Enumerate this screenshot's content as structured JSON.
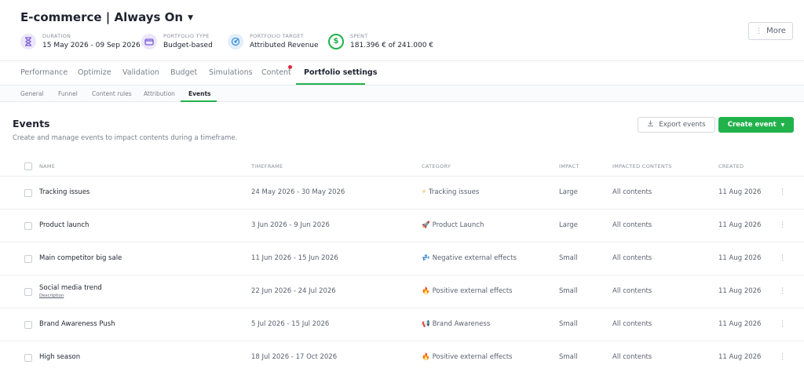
{
  "header": {
    "title": "E-commerce | Always On",
    "more_label": "More",
    "meta": [
      {
        "label": "DURATION",
        "value": "15 May 2026 - 09 Sep 2026",
        "icon": "hourglass-icon",
        "color": "#7b5cd6"
      },
      {
        "label": "PORTFOLIO TYPE",
        "value": "Budget-based",
        "icon": "wallet-icon",
        "color": "#7b5cd6"
      },
      {
        "label": "PORTFOLIO TARGET",
        "value": "Attributed Revenue",
        "icon": "target-icon",
        "color": "#3a8fd8"
      },
      {
        "label": "SPENT",
        "value": "181.396 € of 241.000 €",
        "icon": "dollar-circle-icon",
        "color": "#22b24c"
      }
    ]
  },
  "tabs": [
    "Performance",
    "Optimize",
    "Validation",
    "Budget",
    "Simulations",
    "Content",
    "Portfolio settings"
  ],
  "active_tab": "Portfolio settings",
  "subtabs": [
    "General",
    "Funnel",
    "Content rules",
    "Attribution",
    "Events"
  ],
  "active_subtab": "Events",
  "section": {
    "title": "Events",
    "description": "Create and manage events to impact contents during a timeframe.",
    "export_label": "Export events",
    "create_label": "Create event"
  },
  "table": {
    "headers": [
      "NAME",
      "TIMEFRAME",
      "CATEGORY",
      "IMPACT",
      "IMPACTED CONTENTS",
      "CREATED"
    ],
    "rows": [
      {
        "name": "Tracking issues",
        "timeframe": "24 May 2026 - 30 May 2026",
        "category_icon": "⚡",
        "category": "Tracking issues",
        "impact": "Large",
        "impacted": "All contents",
        "created": "11 Aug 2026"
      },
      {
        "name": "Product launch",
        "timeframe": "3 Jun 2026 - 9 Jun 2026",
        "category_icon": "🚀",
        "category": "Product Launch",
        "impact": "Large",
        "impacted": "All contents",
        "created": "11 Aug 2026"
      },
      {
        "name": "Main competitor big sale",
        "timeframe": "11 Jun 2026 - 15 Jun 2026",
        "category_icon": "💤",
        "category": "Negative external effects",
        "impact": "Small",
        "impacted": "All contents",
        "created": "11 Aug 2026"
      },
      {
        "name": "Social media trend",
        "description": "Description",
        "timeframe": "22 Jun 2026 - 24 Jul 2026",
        "category_icon": "🔥",
        "category": "Positive external effects",
        "impact": "Small",
        "impacted": "All contents",
        "created": "11 Aug 2026"
      },
      {
        "name": "Brand Awareness Push",
        "timeframe": "5 Jul 2026 - 15 Jul 2026",
        "category_icon": "📢",
        "category": "Brand Awareness",
        "impact": "Small",
        "impacted": "All contents",
        "created": "11 Aug 2026"
      },
      {
        "name": "High season",
        "timeframe": "18 Jul 2026 - 17 Oct 2026",
        "category_icon": "🔥",
        "category": "Positive external effects",
        "impact": "Small",
        "impacted": "All contents",
        "created": "11 Aug 2026"
      }
    ]
  },
  "colors": {
    "accent": "#22b24c",
    "notification": "#e0283c"
  }
}
